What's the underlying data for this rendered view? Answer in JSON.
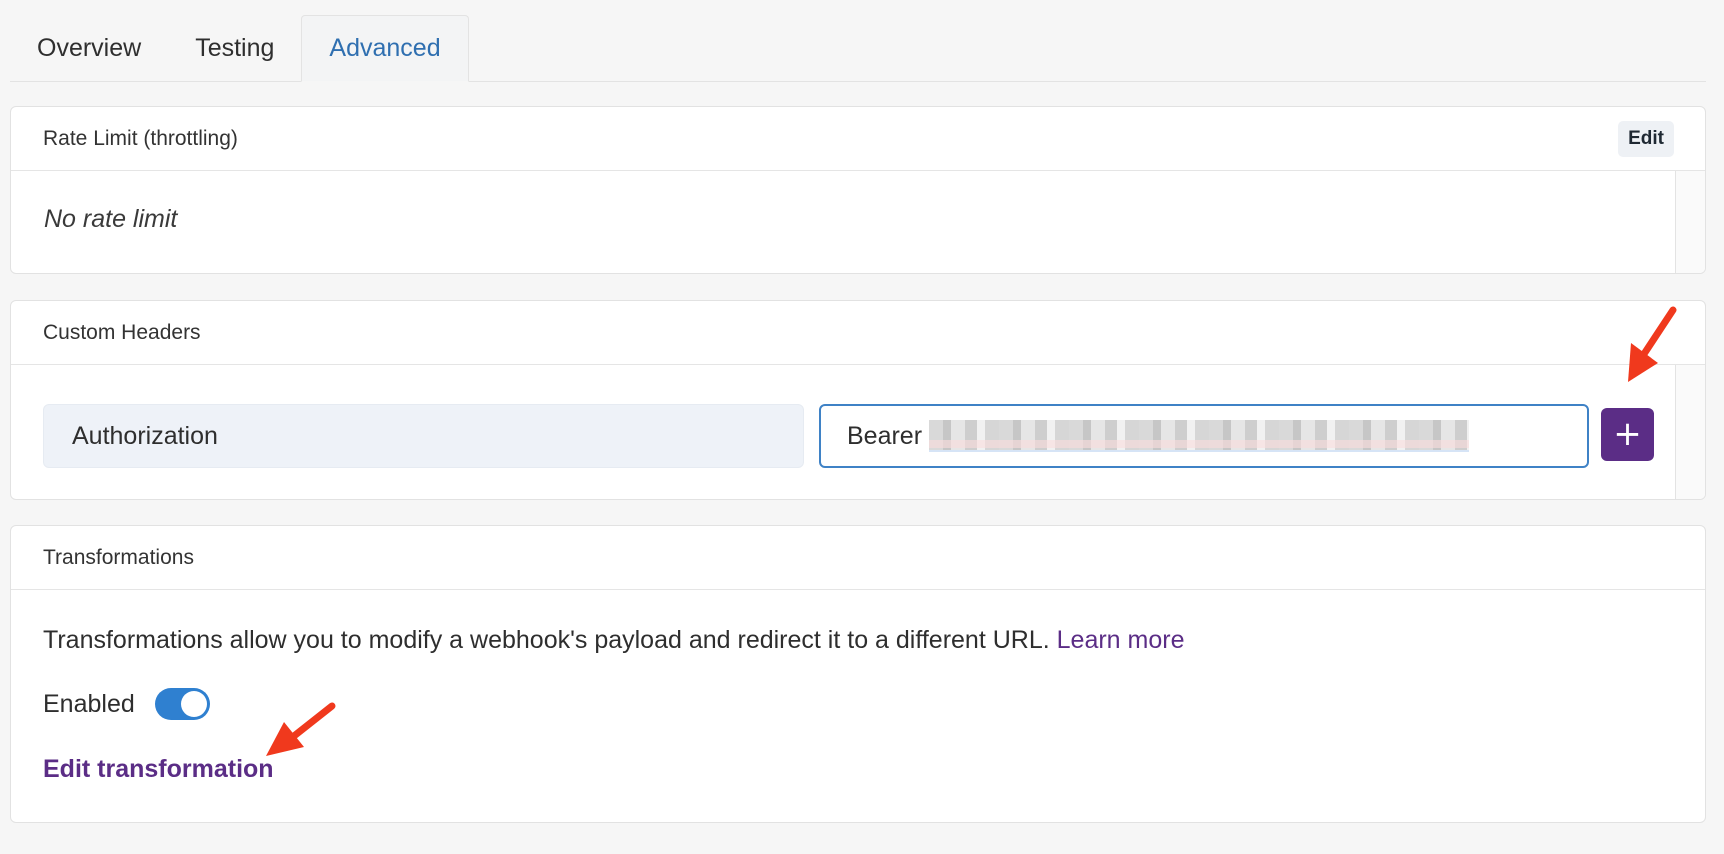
{
  "tabs": [
    {
      "label": "Overview",
      "active": false
    },
    {
      "label": "Testing",
      "active": false
    },
    {
      "label": "Advanced",
      "active": true
    }
  ],
  "rate_limit": {
    "title": "Rate Limit (throttling)",
    "edit_label": "Edit",
    "empty_text": "No rate limit"
  },
  "custom_headers": {
    "title": "Custom Headers",
    "key_value": "Authorization",
    "value_prefix": "Bearer",
    "add_label": "+"
  },
  "transformations": {
    "title": "Transformations",
    "description": "Transformations allow you to modify a webhook's payload and redirect it to a different URL.",
    "learn_more": "Learn more",
    "enabled_label": "Enabled",
    "enabled": true,
    "edit_link": "Edit transformation"
  },
  "colors": {
    "accent_purple": "#5b2d86",
    "tab_active": "#2f6fb0",
    "toggle_on": "#2f80d0",
    "annotation_arrow": "#f0391d"
  }
}
